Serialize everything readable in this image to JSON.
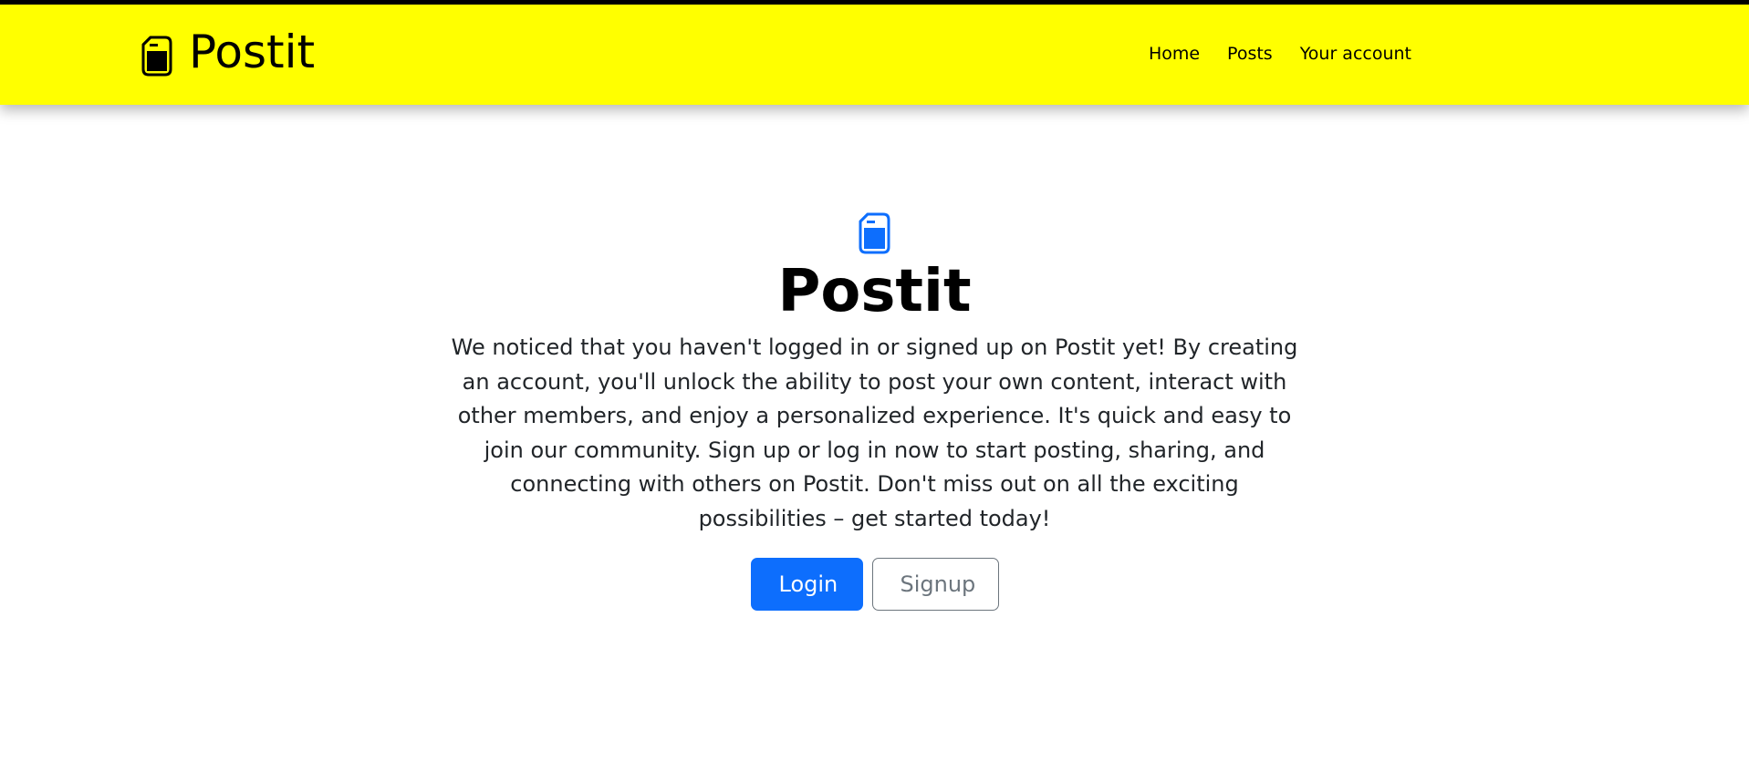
{
  "header": {
    "brand_name": "Postit",
    "brand_icon": "file-icon",
    "nav": [
      {
        "label": "Home"
      },
      {
        "label": "Posts"
      },
      {
        "label": "Your account"
      }
    ]
  },
  "hero": {
    "icon": "file-icon",
    "title": "Postit",
    "message": "We noticed that you haven't logged in or signed up on Postit yet! By creating an account, you'll unlock the ability to post your own content, interact with other members, and enjoy a personalized experience. It's quick and easy to join our community. Sign up or log in now to start posting, sharing, and connecting with others on Postit. Don't miss out on all the exciting possibilities – get started today!",
    "login_label": "Login",
    "signup_label": "Signup"
  },
  "colors": {
    "navbar_bg": "#ffff00",
    "primary": "#0d6efd",
    "secondary": "#6c757d",
    "text": "#000000"
  }
}
